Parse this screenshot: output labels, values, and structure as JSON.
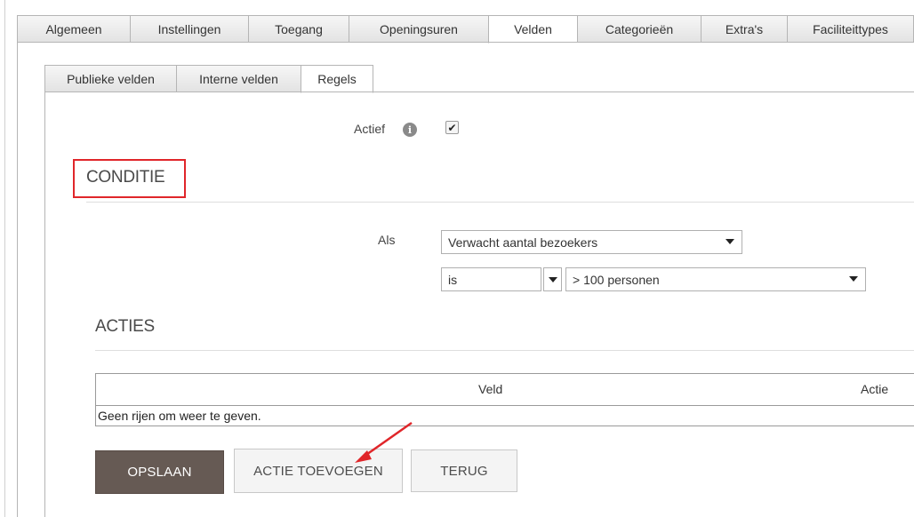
{
  "top_tabs": [
    {
      "label": "Algemeen",
      "active": false
    },
    {
      "label": "Instellingen",
      "active": false
    },
    {
      "label": "Toegang",
      "active": false
    },
    {
      "label": "Openingsuren",
      "active": false
    },
    {
      "label": "Velden",
      "active": true
    },
    {
      "label": "Categorieën",
      "active": false
    },
    {
      "label": "Extra's",
      "active": false
    },
    {
      "label": "Faciliteittypes",
      "active": false
    }
  ],
  "sub_tabs": [
    {
      "label": "Publieke velden",
      "active": false
    },
    {
      "label": "Interne velden",
      "active": false
    },
    {
      "label": "Regels",
      "active": true
    }
  ],
  "actief": {
    "label": "Actief",
    "info_icon": "info-icon",
    "checked": true,
    "check_glyph": "✔"
  },
  "conditie": {
    "title": "CONDITIE",
    "highlight_color": "#e0262a",
    "als_label": "Als",
    "field_select": "Verwacht aantal bezoekers",
    "operator_select": "is",
    "value_select": "> 100 personen"
  },
  "acties": {
    "title": "ACTIES",
    "columns": [
      "Veld",
      "Actie"
    ],
    "empty_text": "Geen rijen om weer te geven."
  },
  "buttons": {
    "save": "OPSLAAN",
    "add_action": "ACTIE TOEVOEGEN",
    "back": "TERUG"
  },
  "colors": {
    "save_button_bg": "#665a54",
    "annotation_arrow": "#e0262a"
  }
}
